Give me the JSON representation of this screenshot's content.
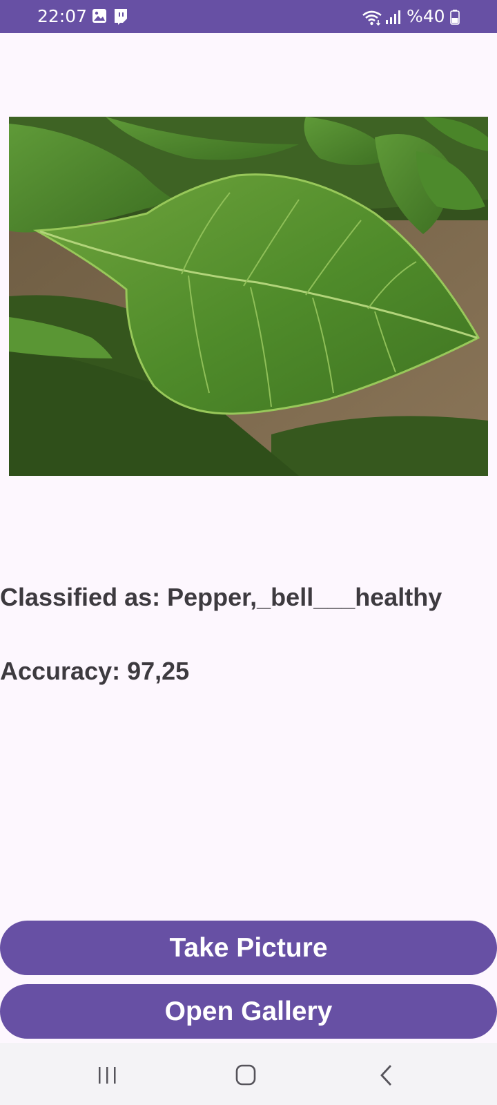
{
  "status_bar": {
    "time": "22:07",
    "battery": "%40",
    "icons": [
      "image-icon",
      "twitch-icon",
      "wifi-icon",
      "signal-icon",
      "battery-icon"
    ]
  },
  "main": {
    "image": {
      "icon": "leaf-photo",
      "subject": "pepper bell leaf"
    },
    "classified_text": "Classified as: Pepper,_bell___healthy",
    "accuracy_text": "Accuracy: 97,25"
  },
  "buttons": {
    "take_picture": "Take Picture",
    "open_gallery": "Open Gallery"
  },
  "nav_bar": {
    "icons": [
      "recent-apps-icon",
      "home-icon",
      "back-icon"
    ]
  },
  "colors": {
    "primary": "#6750A4",
    "background": "#FDF7FE",
    "text": "#3d3a3f",
    "nav_background": "#F4F3F6"
  }
}
